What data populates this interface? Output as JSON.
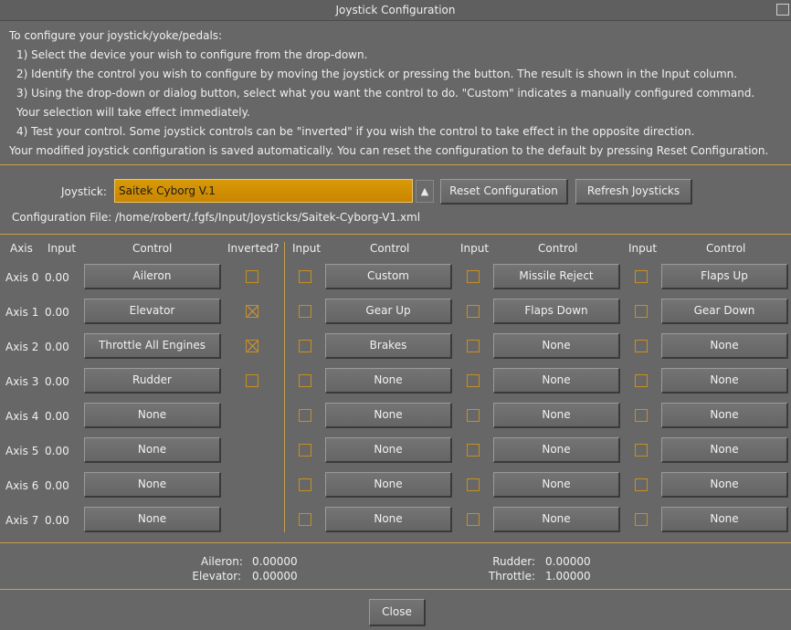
{
  "window": {
    "title": "Joystick Configuration"
  },
  "instructions": [
    "To configure your joystick/yoke/pedals:",
    "1) Select the device your wish to configure from the drop-down.",
    "2) Identify the control you wish to configure by moving the joystick or pressing the button.  The result is shown in the Input column.",
    "3) Using the drop-down or dialog button, select what you want the control to do.  \"Custom\" indicates a manually configured command.",
    "Your selection will take effect immediately.",
    "4) Test your control.  Some joystick controls can be \"inverted\" if you wish the control to take effect in the opposite direction.",
    "Your modified joystick configuration is saved automatically.  You can reset the configuration to the default by pressing Reset Configuration."
  ],
  "device": {
    "label": "Joystick:",
    "value": "Saitek Cyborg V.1",
    "arrow": "▲",
    "reset_label": "Reset Configuration",
    "refresh_label": "Refresh Joysticks",
    "config_file_label": "Configuration File:",
    "config_file_path": "/home/robert/.fgfs/Input/Joysticks/Saitek-Cyborg-V1.xml"
  },
  "axes_headers": {
    "axis": "Axis",
    "input": "Input",
    "control": "Control",
    "inverted": "Inverted?"
  },
  "button_headers": {
    "input": "Input",
    "control": "Control"
  },
  "axes": [
    {
      "name": "Axis 0",
      "input": "0.00",
      "control": "Aileron",
      "inverted": false,
      "has_invert": true
    },
    {
      "name": "Axis 1",
      "input": "0.00",
      "control": "Elevator",
      "inverted": true,
      "has_invert": true
    },
    {
      "name": "Axis 2",
      "input": "0.00",
      "control": "Throttle All Engines",
      "inverted": true,
      "has_invert": true
    },
    {
      "name": "Axis 3",
      "input": "0.00",
      "control": "Rudder",
      "inverted": false,
      "has_invert": true
    },
    {
      "name": "Axis 4",
      "input": "0.00",
      "control": "None",
      "inverted": false,
      "has_invert": false
    },
    {
      "name": "Axis 5",
      "input": "0.00",
      "control": "None",
      "inverted": false,
      "has_invert": false
    },
    {
      "name": "Axis 6",
      "input": "0.00",
      "control": "None",
      "inverted": false,
      "has_invert": false
    },
    {
      "name": "Axis 7",
      "input": "0.00",
      "control": "None",
      "inverted": false,
      "has_invert": false
    }
  ],
  "buttons": [
    [
      "Custom",
      "Missile Reject",
      "Flaps Up"
    ],
    [
      "Gear Up",
      "Flaps Down",
      "Gear Down"
    ],
    [
      "Brakes",
      "None",
      "None"
    ],
    [
      "None",
      "None",
      "None"
    ],
    [
      "None",
      "None",
      "None"
    ],
    [
      "None",
      "None",
      "None"
    ],
    [
      "None",
      "None",
      "None"
    ],
    [
      "None",
      "None",
      "None"
    ]
  ],
  "status": [
    {
      "label": "Aileron:",
      "value": "0.00000"
    },
    {
      "label": "Elevator:",
      "value": "0.00000"
    },
    {
      "label": "Rudder:",
      "value": "0.00000"
    },
    {
      "label": "Throttle:",
      "value": "1.00000"
    }
  ],
  "footer": {
    "close_label": "Close"
  },
  "colors": {
    "background": "#676767",
    "accent": "#c8a048",
    "dropdown": "#d99a08"
  }
}
